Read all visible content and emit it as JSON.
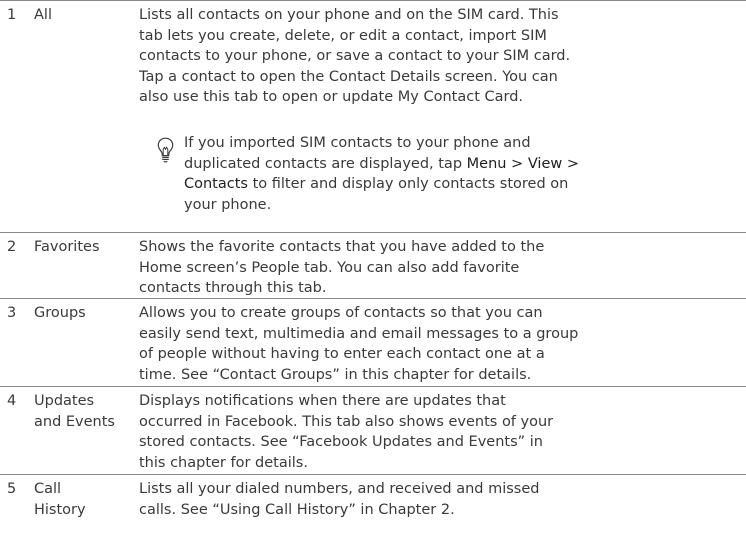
{
  "rows": [
    {
      "num": "1",
      "name": [
        "All"
      ],
      "desc": [
        "Lists all contacts on your phone and on the SIM card. This",
        "tab lets you create, delete, or edit a contact, import SIM",
        "contacts to your phone, or save a contact to your SIM card.",
        "Tap a contact to open the Contact Details screen. You can",
        "also use this tab to open or update My Contact Card."
      ],
      "tip": {
        "icon": "lightbulb-icon",
        "line1": "If you imported SIM contacts to your phone and",
        "line2_pre": "duplicated contacts are displayed, tap ",
        "line2_menu": "Menu > View >",
        "line3_menu": "Contacts",
        "line3_post": " to filter and display only contacts stored on",
        "line4": "your phone."
      }
    },
    {
      "num": "2",
      "name": [
        "Favorites"
      ],
      "desc": [
        "Shows the favorite contacts that you have added to the",
        "Home screen’s People tab. You can also add favorite",
        "contacts through this tab."
      ]
    },
    {
      "num": "3",
      "name": [
        "Groups"
      ],
      "desc": [
        "Allows you to create groups of contacts so that you can",
        "easily send text, multimedia and email messages to a group",
        "of people without having to enter each contact one at a",
        "time. See “Contact Groups” in this chapter for details."
      ]
    },
    {
      "num": "4",
      "name": [
        "Updates",
        "and Events"
      ],
      "desc": [
        "Displays notifications when there are updates that",
        "occurred in Facebook. This tab also shows events of your",
        "stored contacts. See “Facebook Updates and Events” in",
        "this chapter for details."
      ]
    },
    {
      "num": "5",
      "name": [
        "Call",
        "History"
      ],
      "desc": [
        "Lists all your dialed numbers, and received and missed",
        "calls. See “Using Call History” in Chapter 2."
      ]
    }
  ]
}
